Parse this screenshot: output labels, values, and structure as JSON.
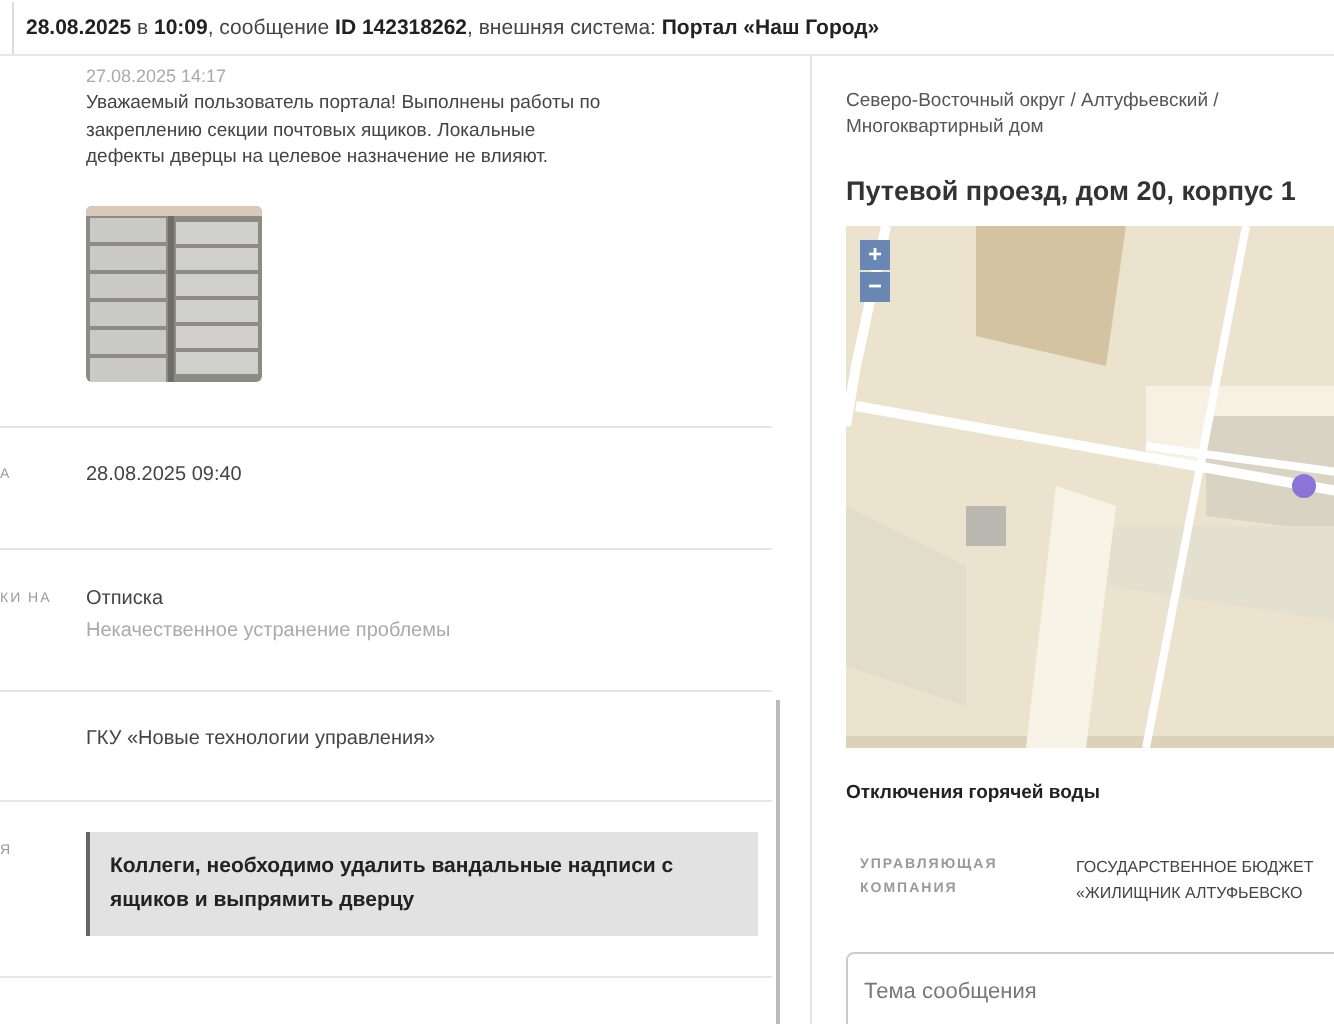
{
  "header": {
    "text": "**28.08.2025** в **10:09**, сообщение **ID 142318262**, внешняя система: **Портал «Наш Город»**"
  },
  "message": {
    "date": "27.08.2025 14:17",
    "text": "Уважаемый пользователь портала! Выполнены работы по закреплению секции почтовых ящиков. Локальные дефекты дверцы на целевое назначение не влияют."
  },
  "rows": [
    {
      "kind": "text",
      "label": "А",
      "value": "28.08.2025 09:40"
    },
    {
      "kind": "reason",
      "label": "КИ НА",
      "value": "Отписка",
      "note": "Некачественное устранение проблемы"
    },
    {
      "kind": "text",
      "value": "ГКУ «Новые технологии управления»"
    },
    {
      "kind": "quote",
      "label": "Я",
      "value": "Коллеги, необходимо удалить вандальные надписи с ящиков и выпрямить дверцу"
    }
  ],
  "address": {
    "breadcrumb": "Северо-Восточный округ / Алтуфьевский / Многоквартирный дом",
    "title": "Путевой проезд, дом 20, корпус 1"
  },
  "map": {
    "zoom_in": "+",
    "zoom_out": "−"
  },
  "hot_water": {
    "title": "Отключения горячей воды"
  },
  "management": {
    "label": "УПРАВЛЯЮЩАЯ КОМПАНИЯ",
    "value_lines": [
      "ГОСУДАРСТВЕННОЕ БЮДЖЕТ",
      "«ЖИЛИЩНИК АЛТУФЬЕВСКО"
    ]
  },
  "subject_field": {
    "placeholder": "Тема сообщения"
  }
}
